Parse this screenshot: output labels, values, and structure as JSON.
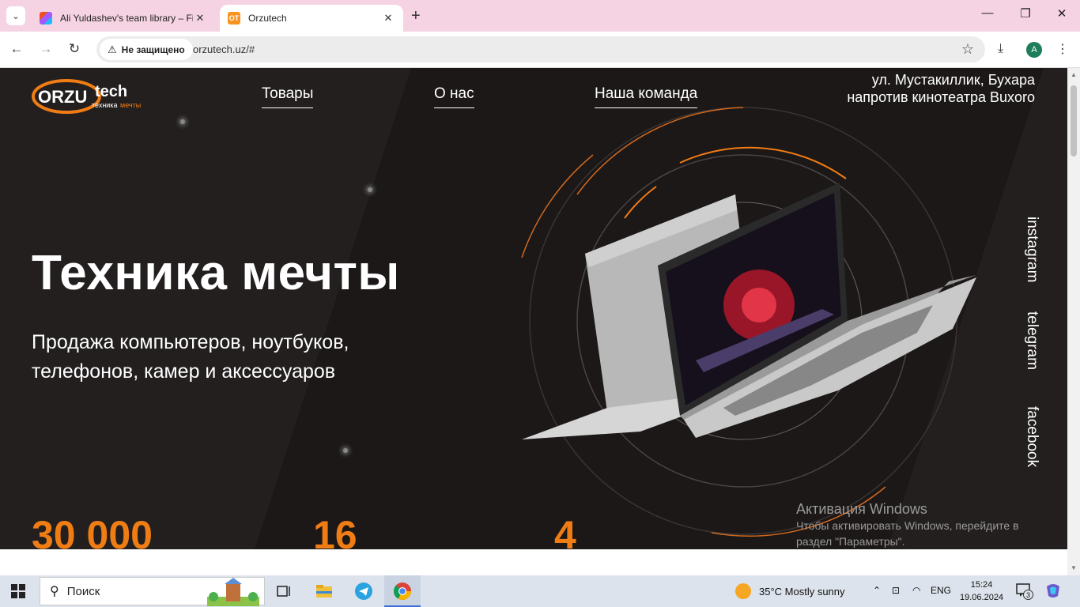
{
  "browser": {
    "tabs": [
      {
        "title": "Ali Yuldashev's team library – Fi",
        "active": false
      },
      {
        "title": "Orzutech",
        "active": true
      }
    ],
    "security_label": "Не защищено",
    "url": "orzutech.uz/#",
    "profile_initial": "A"
  },
  "site": {
    "logo": {
      "brand_left": "ORZU",
      "brand_right": "tech",
      "tagline_left": "техника",
      "tagline_right": "мечты"
    },
    "nav": [
      "Товары",
      "О нас",
      "Наша команда"
    ],
    "address": {
      "line1": "ул. Мустакиллик, Бухара",
      "line2": "напротив кинотеатра Buxoro"
    },
    "hero_title": "Техника мечты",
    "hero_subtitle": "Продажа компьютеров, ноутбуков, телефонов, камер и аксессуаров",
    "stats": [
      "30 000",
      "16",
      "4"
    ],
    "social": [
      "instagram",
      "telegram",
      "facebook"
    ],
    "colors": {
      "accent": "#f07c14",
      "background": "#231f1f"
    }
  },
  "watermark": {
    "title": "Активация Windows",
    "text": "Чтобы активировать Windows, перейдите в раздел \"Параметры\"."
  },
  "taskbar": {
    "search_placeholder": "Поиск",
    "weather": "35°C  Mostly sunny",
    "language": "ENG",
    "time": "15:24",
    "date": "19.06.2024",
    "notifications": "3"
  }
}
